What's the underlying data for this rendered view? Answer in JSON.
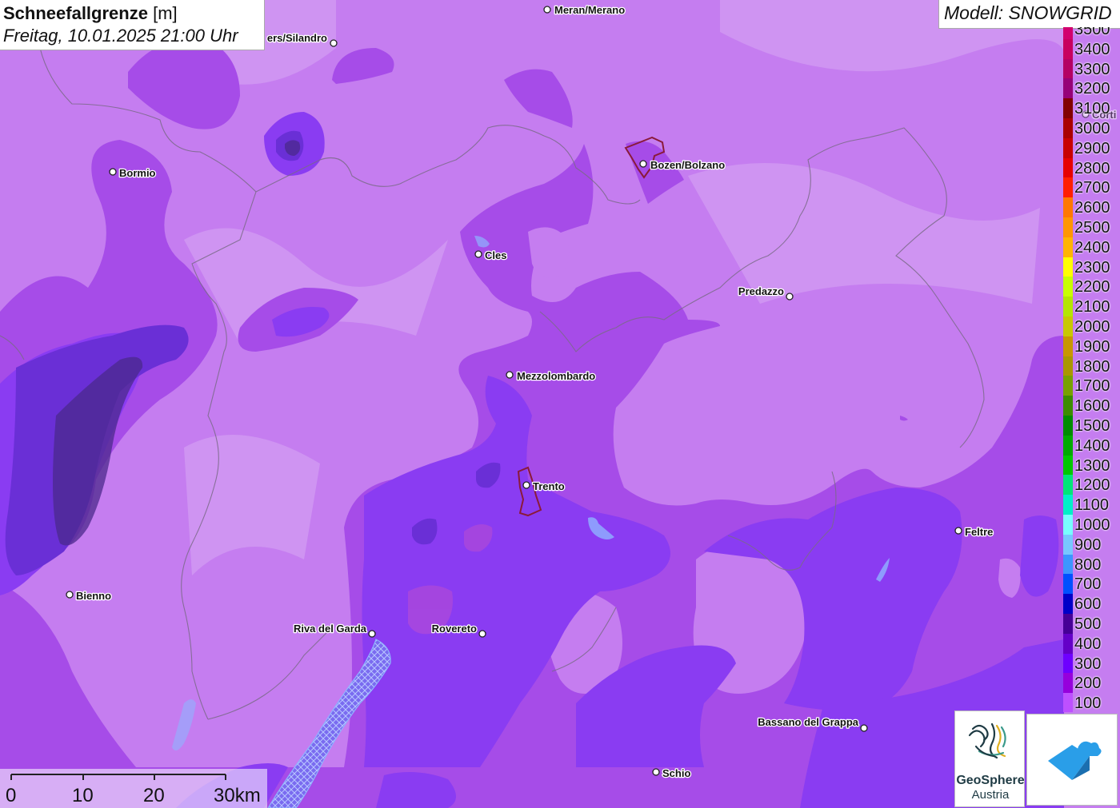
{
  "title": {
    "main": "Schneefallgrenze",
    "unit": "[m]",
    "datetime": "Freitag, 10.01.2025 21:00 Uhr"
  },
  "model": "Modell: SNOWGRID",
  "cities": [
    {
      "name": "Meran/Merano",
      "id": "meran"
    },
    {
      "name": "ers/Silandro",
      "id": "silandro"
    },
    {
      "name": "Bormio",
      "id": "bormio"
    },
    {
      "name": "Bozen/Bolzano",
      "id": "bozen"
    },
    {
      "name": "Cles",
      "id": "cles"
    },
    {
      "name": "Predazzo",
      "id": "predazzo"
    },
    {
      "name": "Mezzolombardo",
      "id": "mezzolombardo"
    },
    {
      "name": "Trento",
      "id": "trento"
    },
    {
      "name": "Feltre",
      "id": "feltre"
    },
    {
      "name": "Bienno",
      "id": "bienno"
    },
    {
      "name": "Riva del Garda",
      "id": "riva"
    },
    {
      "name": "Rovereto",
      "id": "rovereto"
    },
    {
      "name": "Bassano del Grappa",
      "id": "bassano"
    },
    {
      "name": "Schio",
      "id": "schio"
    },
    {
      "name": "Corti",
      "id": "corti"
    }
  ],
  "legend": [
    {
      "label": "3500",
      "color": "#d2006e"
    },
    {
      "label": "3400",
      "color": "#c8005f"
    },
    {
      "label": "3300",
      "color": "#b40064"
    },
    {
      "label": "3200",
      "color": "#960078"
    },
    {
      "label": "3100",
      "color": "#820000"
    },
    {
      "label": "3000",
      "color": "#aa0000"
    },
    {
      "label": "2900",
      "color": "#c80000"
    },
    {
      "label": "2800",
      "color": "#e60000"
    },
    {
      "label": "2700",
      "color": "#ff1e00"
    },
    {
      "label": "2600",
      "color": "#ff7800"
    },
    {
      "label": "2500",
      "color": "#ff9600"
    },
    {
      "label": "2400",
      "color": "#ffb400"
    },
    {
      "label": "2300",
      "color": "#ffff00"
    },
    {
      "label": "2200",
      "color": "#c8ff00"
    },
    {
      "label": "2100",
      "color": "#b4e600"
    },
    {
      "label": "2000",
      "color": "#c8c800"
    },
    {
      "label": "1900",
      "color": "#c89600"
    },
    {
      "label": "1800",
      "color": "#aa9600"
    },
    {
      "label": "1700",
      "color": "#78a000"
    },
    {
      "label": "1600",
      "color": "#3c8c00"
    },
    {
      "label": "1500",
      "color": "#008c00"
    },
    {
      "label": "1400",
      "color": "#00aa00"
    },
    {
      "label": "1300",
      "color": "#00c800"
    },
    {
      "label": "1200",
      "color": "#00e678"
    },
    {
      "label": "1100",
      "color": "#00f0c8"
    },
    {
      "label": "1000",
      "color": "#78ffff"
    },
    {
      "label": "900",
      "color": "#78c8ff"
    },
    {
      "label": "800",
      "color": "#3c96ff"
    },
    {
      "label": "700",
      "color": "#0050ff"
    },
    {
      "label": "600",
      "color": "#0000c8"
    },
    {
      "label": "500",
      "color": "#460096"
    },
    {
      "label": "400",
      "color": "#6400c8"
    },
    {
      "label": "300",
      "color": "#6e00ff"
    },
    {
      "label": "200",
      "color": "#9600dc"
    },
    {
      "label": "100",
      "color": "#be50ff"
    }
  ],
  "scale": {
    "labels": [
      "0",
      "10",
      "20",
      "30km"
    ]
  },
  "logos": {
    "geosphere_line1": "GeoSphere",
    "geosphere_line2": "Austria"
  },
  "colors": {
    "base": "#c57df0",
    "band_200": "#a64ce8",
    "band_300": "#8a3cf2",
    "band_400": "#6a2fd6",
    "band_500": "#4b2a8c"
  }
}
